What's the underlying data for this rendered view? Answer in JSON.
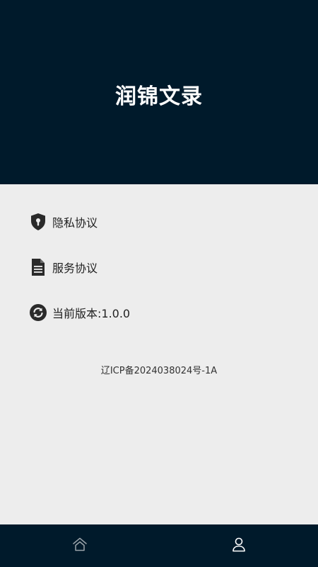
{
  "header": {
    "title": "润锦文录",
    "background": "#001a2b"
  },
  "menu": {
    "items": [
      {
        "label": "隐私协议",
        "icon": "shield-keyhole-icon"
      },
      {
        "label": "服务协议",
        "icon": "document-icon"
      },
      {
        "label": "当前版本:1.0.0",
        "icon": "refresh-icon"
      }
    ]
  },
  "footer": {
    "icp": "辽ICP备2024038024号-1A"
  },
  "tabbar": {
    "tabs": [
      {
        "icon": "home-icon",
        "active": false
      },
      {
        "icon": "user-icon",
        "active": true
      }
    ],
    "background": "#001a2b"
  }
}
